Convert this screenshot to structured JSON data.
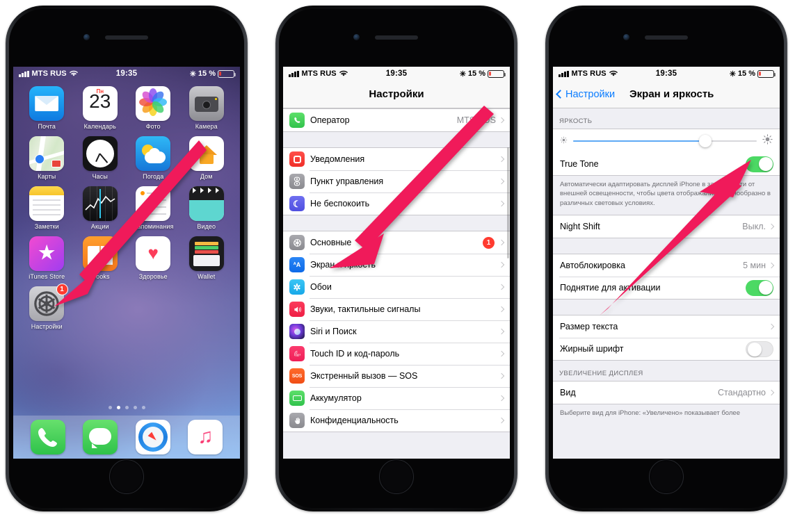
{
  "status_bar": {
    "carrier": "MTS RUS",
    "time": "19:35",
    "battery_percent": "15 %"
  },
  "phone1": {
    "name": "home-screen",
    "apps_rows": [
      [
        {
          "label": "Почта",
          "icon": "mail-icon"
        },
        {
          "label": "Календарь",
          "icon": "calendar-icon",
          "day": "Пн",
          "date": "23"
        },
        {
          "label": "Фото",
          "icon": "photos-icon"
        },
        {
          "label": "Камера",
          "icon": "camera-icon"
        }
      ],
      [
        {
          "label": "Карты",
          "icon": "maps-icon"
        },
        {
          "label": "Часы",
          "icon": "clock-icon"
        },
        {
          "label": "Погода",
          "icon": "weather-icon"
        },
        {
          "label": "Дом",
          "icon": "home-app-icon"
        }
      ],
      [
        {
          "label": "Заметки",
          "icon": "notes-icon"
        },
        {
          "label": "Акции",
          "icon": "stocks-icon"
        },
        {
          "label": "Напоминания",
          "icon": "reminders-icon"
        },
        {
          "label": "Видео",
          "icon": "videos-icon"
        }
      ],
      [
        {
          "label": "iTunes Store",
          "icon": "itunes-store-icon"
        },
        {
          "label": "iBooks",
          "icon": "ibooks-icon"
        },
        {
          "label": "Здоровье",
          "icon": "health-icon"
        },
        {
          "label": "Wallet",
          "icon": "wallet-icon"
        }
      ],
      [
        {
          "label": "Настройки",
          "icon": "settings-icon",
          "badge": "1"
        }
      ]
    ],
    "page_dots": {
      "count": 5,
      "active_index": 1
    },
    "dock": [
      {
        "label": "Телефон",
        "icon": "phone-icon"
      },
      {
        "label": "Сообщения",
        "icon": "messages-icon"
      },
      {
        "label": "Safari",
        "icon": "safari-icon"
      },
      {
        "label": "Музыка",
        "icon": "music-icon"
      }
    ]
  },
  "phone2": {
    "nav_title": "Настройки",
    "groups": [
      {
        "rows": [
          {
            "label": "Оператор",
            "value": "MTS RUS",
            "icon": "phone-green-icon",
            "chevron": true
          }
        ]
      },
      {
        "rows": [
          {
            "label": "Уведомления",
            "icon": "notifications-icon",
            "chevron": true
          },
          {
            "label": "Пункт управления",
            "icon": "control-center-icon",
            "chevron": true
          },
          {
            "label": "Не беспокоить",
            "icon": "do-not-disturb-icon",
            "chevron": true
          }
        ]
      },
      {
        "rows": [
          {
            "label": "Основные",
            "icon": "general-icon",
            "badge": "1",
            "chevron": true
          },
          {
            "label": "Экран и яркость",
            "icon": "display-brightness-icon",
            "chevron": true
          },
          {
            "label": "Обои",
            "icon": "wallpaper-icon",
            "chevron": true
          },
          {
            "label": "Звуки, тактильные сигналы",
            "icon": "sounds-icon",
            "chevron": true
          },
          {
            "label": "Siri и Поиск",
            "icon": "siri-icon",
            "chevron": true
          },
          {
            "label": "Touch ID и код-пароль",
            "icon": "touch-id-icon",
            "chevron": true
          },
          {
            "label": "Экстренный вызов — SOS",
            "icon": "sos-icon",
            "chevron": true
          },
          {
            "label": "Аккумулятор",
            "icon": "battery-icon",
            "chevron": true
          },
          {
            "label": "Конфиденциальность",
            "icon": "privacy-icon",
            "chevron": true
          }
        ]
      }
    ]
  },
  "phone3": {
    "back_label": "Настройки",
    "nav_title": "Экран и яркость",
    "brightness_section_label": "ЯРКОСТЬ",
    "brightness_value_percent": 72,
    "rows": {
      "true_tone": {
        "label": "True Tone",
        "toggle": "on"
      },
      "true_tone_note": "Автоматически адаптировать дисплей iPhone в зависимости от внешней освещенности, чтобы цвета отображались единообразно в различных световых условиях.",
      "night_shift": {
        "label": "Night Shift",
        "value": "Выкл.",
        "chevron": true
      },
      "auto_lock": {
        "label": "Автоблокировка",
        "value": "5 мин",
        "chevron": true
      },
      "raise_to_wake": {
        "label": "Поднятие для активации",
        "toggle": "on"
      },
      "text_size": {
        "label": "Размер текста",
        "chevron": true
      },
      "bold_text": {
        "label": "Жирный шрифт",
        "toggle": "off"
      },
      "display_zoom_label": "УВЕЛИЧЕНИЕ ДИСПЛЕЯ",
      "view": {
        "label": "Вид",
        "value": "Стандартно",
        "chevron": true
      },
      "view_note": "Выберите вид для iPhone: «Увеличено» показывает более"
    }
  },
  "annotations": {
    "arrow_color": "#f01a5a",
    "arrows": [
      {
        "name": "arrow-to-settings-app",
        "direction": "down-left"
      },
      {
        "name": "arrow-to-display-brightness-row",
        "direction": "down-left"
      },
      {
        "name": "arrow-to-true-tone-toggle",
        "direction": "up-right"
      }
    ]
  }
}
